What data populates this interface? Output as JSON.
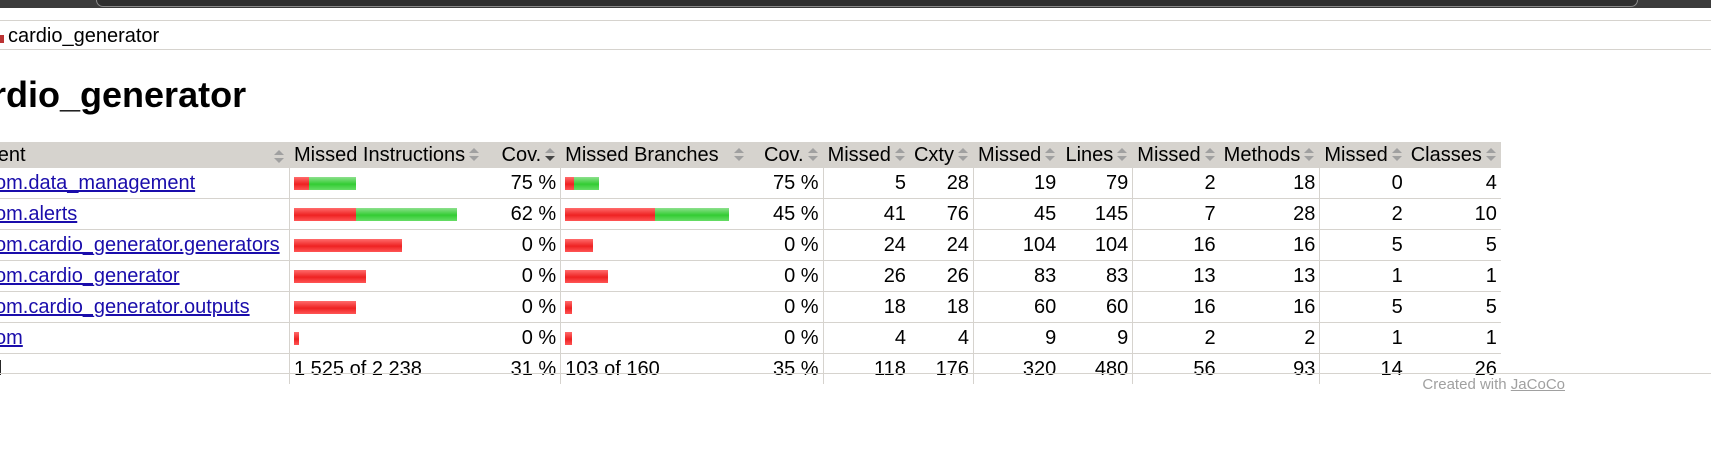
{
  "breadcrumb": {
    "label": "cardio_generator"
  },
  "title": "ardio_generator",
  "table": {
    "headers": {
      "element": "ement",
      "missed_instructions": "Missed Instructions",
      "cov1": "Cov.",
      "missed_branches": "Missed Branches",
      "cov2": "Cov.",
      "missed_cxty": "Missed",
      "cxty": "Cxty",
      "missed_lines": "Missed",
      "lines": "Lines",
      "missed_methods": "Missed",
      "methods": "Methods",
      "missed_classes": "Missed",
      "classes": "Classes"
    },
    "rows": [
      {
        "name": "com.data_management",
        "instr_cov": "75 %",
        "branch_cov": "75 %",
        "missed_cxty": "5",
        "cxty": "28",
        "missed_lines": "19",
        "lines": "79",
        "missed_methods": "2",
        "methods": "18",
        "missed_classes": "0",
        "classes": "4",
        "instr_bar": {
          "missed": 0.25,
          "total_scale": 0.38
        },
        "branch_bar": {
          "missed": 0.25,
          "total_scale": 0.21
        }
      },
      {
        "name": "com.alerts",
        "instr_cov": "62 %",
        "branch_cov": "45 %",
        "missed_cxty": "41",
        "cxty": "76",
        "missed_lines": "45",
        "lines": "145",
        "missed_methods": "7",
        "methods": "28",
        "missed_classes": "2",
        "classes": "10",
        "instr_bar": {
          "missed": 0.38,
          "total_scale": 1.0
        },
        "branch_bar": {
          "missed": 0.55,
          "total_scale": 1.0
        }
      },
      {
        "name": "com.cardio_generator.generators",
        "instr_cov": "0 %",
        "branch_cov": "0 %",
        "missed_cxty": "24",
        "cxty": "24",
        "missed_lines": "104",
        "lines": "104",
        "missed_methods": "16",
        "methods": "16",
        "missed_classes": "5",
        "classes": "5",
        "instr_bar": {
          "missed": 1.0,
          "total_scale": 0.66
        },
        "branch_bar": {
          "missed": 1.0,
          "total_scale": 0.17
        }
      },
      {
        "name": "com.cardio_generator",
        "instr_cov": "0 %",
        "branch_cov": "0 %",
        "missed_cxty": "26",
        "cxty": "26",
        "missed_lines": "83",
        "lines": "83",
        "missed_methods": "13",
        "methods": "13",
        "missed_classes": "1",
        "classes": "1",
        "instr_bar": {
          "missed": 1.0,
          "total_scale": 0.44
        },
        "branch_bar": {
          "missed": 1.0,
          "total_scale": 0.26
        }
      },
      {
        "name": "com.cardio_generator.outputs",
        "instr_cov": "0 %",
        "branch_cov": "0 %",
        "missed_cxty": "18",
        "cxty": "18",
        "missed_lines": "60",
        "lines": "60",
        "missed_methods": "16",
        "methods": "16",
        "missed_classes": "5",
        "classes": "5",
        "instr_bar": {
          "missed": 1.0,
          "total_scale": 0.38
        },
        "branch_bar": {
          "missed": 1.0,
          "total_scale": 0.04
        }
      },
      {
        "name": "com",
        "instr_cov": "0 %",
        "branch_cov": "0 %",
        "missed_cxty": "4",
        "cxty": "4",
        "missed_lines": "9",
        "lines": "9",
        "missed_methods": "2",
        "methods": "2",
        "missed_classes": "1",
        "classes": "1",
        "instr_bar": {
          "missed": 1.0,
          "total_scale": 0.03
        },
        "branch_bar": {
          "missed": 1.0,
          "total_scale": 0.04
        }
      }
    ],
    "total": {
      "label": "otal",
      "instructions": "1 525 of 2 238",
      "instr_cov": "31 %",
      "branches": "103 of 160",
      "branch_cov": "35 %",
      "missed_cxty": "118",
      "cxty": "176",
      "missed_lines": "320",
      "lines": "480",
      "missed_methods": "56",
      "methods": "93",
      "missed_classes": "14",
      "classes": "26"
    }
  },
  "footer": {
    "prefix": "Created with ",
    "link": "JaCoCo"
  },
  "colors": {
    "header_bg": "#d6d3ce",
    "missed": "#ee2222",
    "covered": "#33cc33",
    "link": "#1a0dab"
  },
  "icons": {
    "breadcrumb": "report-icon",
    "package": "package-icon",
    "sort": "sort-icon"
  }
}
